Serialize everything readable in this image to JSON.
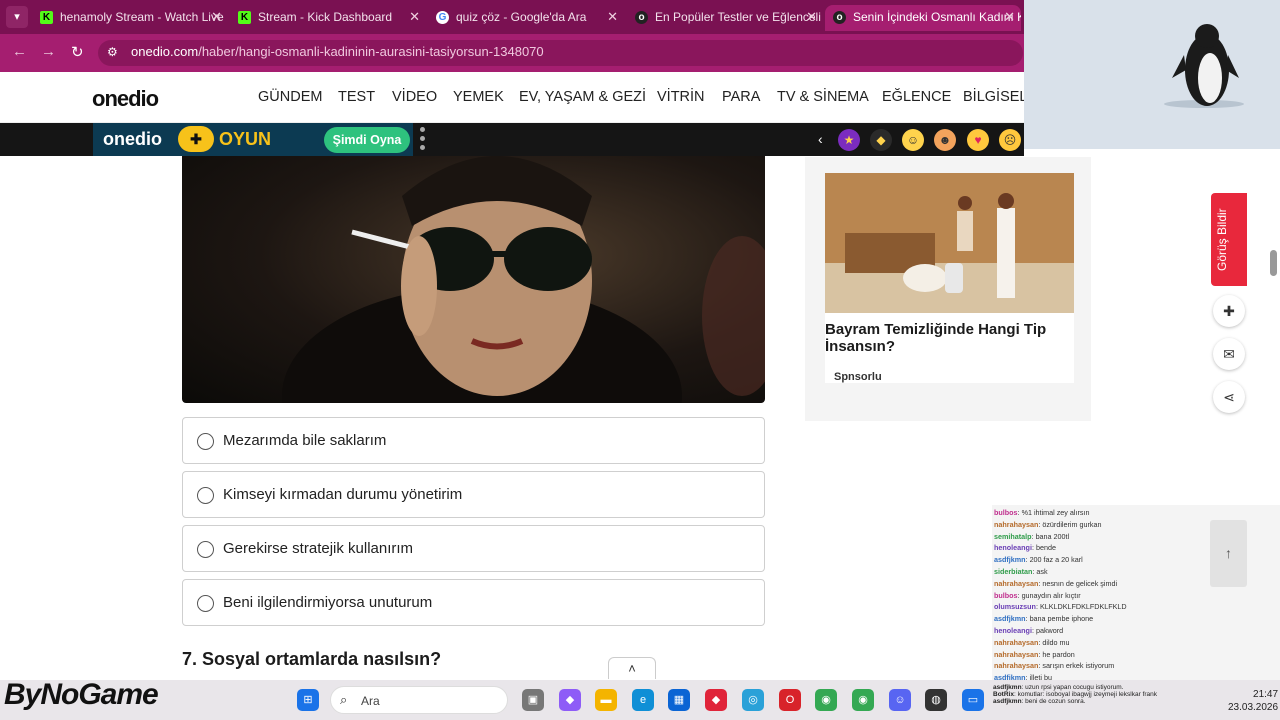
{
  "browser": {
    "tabs": [
      {
        "title": "henamoly Stream - Watch Live",
        "icon": "kick-icon",
        "active": false
      },
      {
        "title": "Stream - Kick Dashboard",
        "icon": "kick-icon",
        "active": false
      },
      {
        "title": "quiz çöz - Google'da Ara",
        "icon": "google-icon",
        "active": false
      },
      {
        "title": "En Popüler Testler ve Eğlenceli",
        "icon": "onedio-icon",
        "active": false
      },
      {
        "title": "Senin İçindeki Osmanlı Kadını K",
        "icon": "onedio-icon",
        "active": true
      }
    ],
    "url_domain": "onedio.com",
    "url_path": "/haber/hangi-osmanli-kadininin-aurasini-tasiyorsun-1348070",
    "colors": {
      "tabbar": "#7a1152",
      "active_tab": "#a51e70"
    }
  },
  "site": {
    "logo": "onedio",
    "nav": [
      "GÜNDEM",
      "TEST",
      "VİDEO",
      "YEMEK",
      "EV, YAŞAM & GEZİ",
      "VİTRİN",
      "PARA",
      "TV & SİNEMA",
      "EĞLENCE",
      "BİLGİSEL"
    ],
    "oyun": {
      "logo": "onedio",
      "word": "OYUN",
      "cta": "Şimdi Oyna"
    }
  },
  "quiz": {
    "options": [
      "Mezarımda bile saklarım",
      "Kimseyi kırmadan durumu yönetirim",
      "Gerekirse stratejik kullanırım",
      "Beni ilgilendirmiyorsa unuturum"
    ],
    "next_question": "7. Sosyal ortamlarda nasılsın?"
  },
  "ad": {
    "title": "Bayram Temizliğinde Hangi Tip İnsansın?",
    "sponsor": "Spnsorlu"
  },
  "feedback": {
    "label": "Görüş Bildir"
  },
  "chat": [
    {
      "user": "bulbos",
      "msg": "%1 ihtimal zey alırsın"
    },
    {
      "user": "nahrahaysan",
      "msg": "özürdilerim gurkan"
    },
    {
      "user": "semihatalp",
      "msg": "bana 200tl"
    },
    {
      "user": "henoleangi",
      "msg": "bende"
    },
    {
      "user": "asdfjkmn",
      "msg": "200 faz a 20 karl"
    },
    {
      "user": "siderbiatan",
      "msg": "ask"
    },
    {
      "user": "nahrahaysan",
      "msg": "nesnın de gelicek şimdi"
    },
    {
      "user": "bulbos",
      "msg": "gunaydın alır kıçtır"
    },
    {
      "user": "olumsuzsun",
      "msg": "KLKLDKLFDKLFDKLFKLD"
    },
    {
      "user": "asdfjkmn",
      "msg": "bana pembe iphone"
    },
    {
      "user": "henoleangi",
      "msg": "pakword"
    },
    {
      "user": "nahrahaysan",
      "msg": "dildo mu"
    },
    {
      "user": "nahrahaysan",
      "msg": "he pardon"
    },
    {
      "user": "nahrahaysan",
      "msg": "sarışın erkek istiyorum"
    },
    {
      "user": "asdfjkmn",
      "msg": "illeti bu"
    },
    {
      "user": "asdfjkmn",
      "msg": "uzun rpsi yapan cocugu istiyorum."
    },
    {
      "user": "BotRix",
      "msg": "komutlar: isoboyal ibagwjj izeymeji lekslkar frank"
    },
    {
      "user": "asdfjkmn",
      "msg": "beni de cozun sonra."
    }
  ],
  "taskbar": {
    "search_label": "Ara",
    "time": "21:47",
    "date": "23.03.2026",
    "watermark": "ByNoGame"
  }
}
